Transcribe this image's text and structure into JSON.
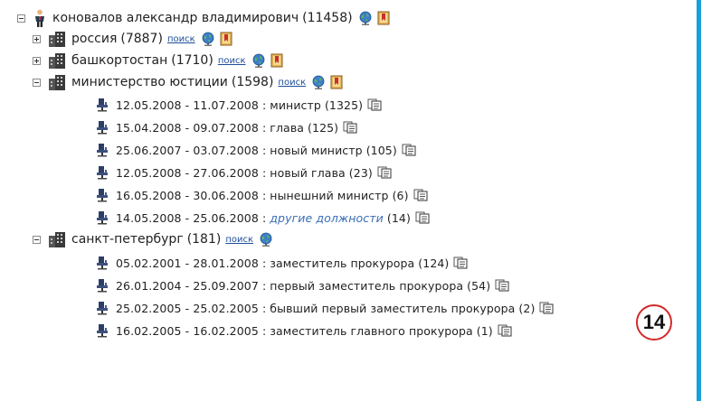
{
  "tree": {
    "root": {
      "label": "коновалов александр владимирович",
      "count": "(11458)"
    },
    "groups": [
      {
        "label": "россия",
        "count": "(7887)",
        "link": "поиск",
        "expander": "plus"
      },
      {
        "label": "башкортостан",
        "count": "(1710)",
        "link": "поиск",
        "expander": "plus"
      },
      {
        "label": "министерство юстиции",
        "count": "(1598)",
        "link": "поиск",
        "expander": "minus"
      },
      {
        "label": "санкт-петербург",
        "count": "(181)",
        "link": "поиск",
        "expander": "minus"
      }
    ],
    "justice_items": [
      {
        "dates": "12.05.2008 - 11.07.2008 :",
        "title": "министр",
        "count": "(1325)"
      },
      {
        "dates": "15.04.2008 - 09.07.2008 :",
        "title": "глава",
        "count": "(125)"
      },
      {
        "dates": "25.06.2007 - 03.07.2008 :",
        "title": "новый министр",
        "count": "(105)"
      },
      {
        "dates": "12.05.2008 - 27.06.2008 :",
        "title": "новый глава",
        "count": "(23)"
      },
      {
        "dates": "16.05.2008 - 30.06.2008 :",
        "title": "нынешний министр",
        "count": "(6)"
      },
      {
        "dates": "14.05.2008 - 25.06.2008 :",
        "title": "другие должности",
        "count": "(14)"
      }
    ],
    "spb_items": [
      {
        "dates": "05.02.2001 - 28.01.2008 :",
        "title": "заместитель прокурора",
        "count": "(124)"
      },
      {
        "dates": "26.01.2004 - 25.09.2007 :",
        "title": "первый заместитель прокурора",
        "count": "(54)"
      },
      {
        "dates": "25.02.2005 - 25.02.2005 :",
        "title": "бывший первый заместитель прокурора",
        "count": "(2)"
      },
      {
        "dates": "16.02.2005 - 16.02.2005 :",
        "title": "заместитель главного прокурора",
        "count": "(1)"
      }
    ]
  },
  "badge": {
    "number": "14"
  },
  "colors": {
    "frame": "#1aa0d8",
    "link": "#1f4e9c",
    "badge_ring": "#d22a2a"
  },
  "icons": [
    "person-icon",
    "building-icon",
    "globe-icon",
    "bookmark-icon",
    "chair-icon",
    "copy-icon"
  ]
}
